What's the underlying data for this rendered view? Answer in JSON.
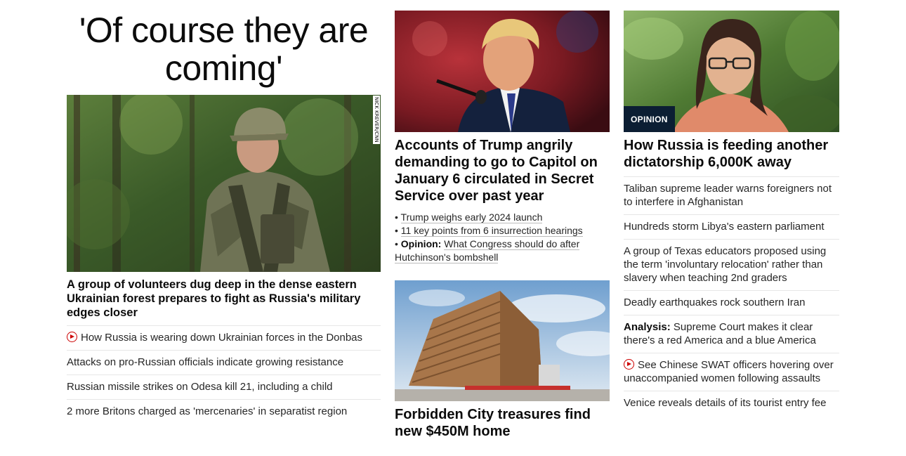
{
  "lead": {
    "big_headline": "'Of course they are coming'",
    "photo_credit": "NICK KREVER/CNN",
    "caption": "A group of volunteers dug deep in the dense eastern Ukrainian forest prepares to fight as Russia's military edges closer",
    "links": [
      {
        "text": "How Russia is wearing down Ukrainian forces in the Donbas",
        "video": true
      },
      {
        "text": "Attacks on pro-Russian officials indicate growing resistance",
        "video": false
      },
      {
        "text": "Russian missile strikes on Odesa kill 21, including a child",
        "video": false
      },
      {
        "text": "2 more Britons charged as 'mercenaries' in separatist region",
        "video": false
      }
    ]
  },
  "middle": {
    "story1": {
      "headline": "Accounts of Trump angrily demanding to go to Capitol on January 6 circulated in Secret Service over past year",
      "bullets": [
        {
          "prefix": "",
          "text": "Trump weighs early 2024 launch"
        },
        {
          "prefix": "",
          "text": "11 key points from 6 insurrection hearings"
        },
        {
          "prefix": "Opinion:",
          "text": "What Congress should do after Hutchinson's bombshell"
        }
      ]
    },
    "story2": {
      "headline": "Forbidden City treasures find new $450M home"
    }
  },
  "right": {
    "badge": "OPINION",
    "headline": "How Russia is feeding another dictatorship 6,000K away",
    "links": [
      {
        "prefix": "",
        "text": "Taliban supreme leader warns foreigners not to interfere in Afghanistan",
        "video": false
      },
      {
        "prefix": "",
        "text": "Hundreds storm Libya's eastern parliament",
        "video": false
      },
      {
        "prefix": "",
        "text": "A group of Texas educators proposed using the term 'involuntary relocation' rather than slavery when teaching 2nd graders",
        "video": false
      },
      {
        "prefix": "",
        "text": "Deadly earthquakes rock southern Iran",
        "video": false
      },
      {
        "prefix": "Analysis:",
        "text": "Supreme Court makes it clear there's a red America and a blue America",
        "video": false
      },
      {
        "prefix": "",
        "text": "See Chinese SWAT officers hovering over unaccompanied women following assaults",
        "video": true
      },
      {
        "prefix": "",
        "text": "Venice reveals details of its tourist entry fee",
        "video": false
      }
    ]
  },
  "colors": {
    "video_red": "#cc0000",
    "badge_bg": "#0c1e33",
    "divider": "#e6e6e6"
  }
}
